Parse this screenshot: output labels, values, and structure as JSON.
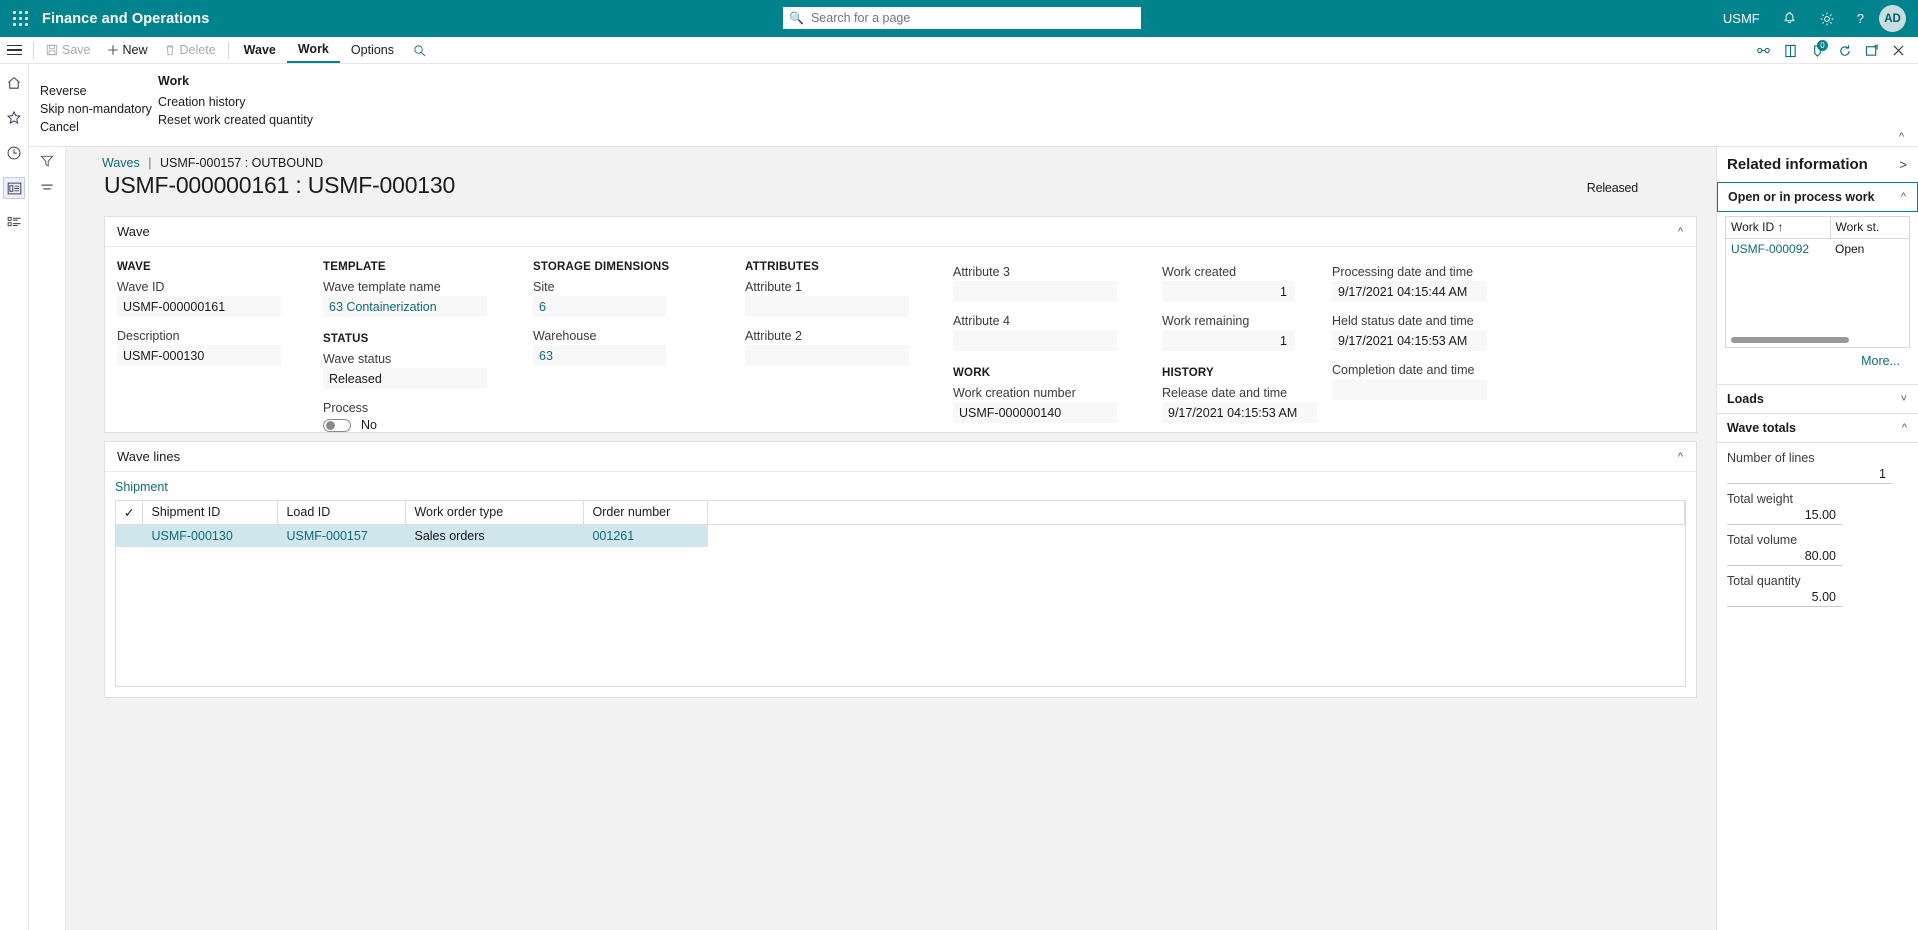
{
  "topbar": {
    "waffle_icon": "app-launcher-icon",
    "brand": "Finance and Operations",
    "search_placeholder": "Search for a page",
    "search_value": "",
    "search_icon": "search-icon",
    "company": "USMF",
    "notifications_icon": "bell-icon",
    "settings_icon": "gear-icon",
    "help_icon": "question-icon",
    "avatar_initials": "AD"
  },
  "commandbar": {
    "menu_icon": "hamburger-icon",
    "save_label": "Save",
    "save_icon": "save-icon",
    "new_label": "New",
    "new_icon": "plus-icon",
    "delete_label": "Delete",
    "delete_icon": "trash-icon",
    "tabs": [
      {
        "label": "Wave",
        "active": false,
        "bold": true
      },
      {
        "label": "Work",
        "active": true,
        "bold": true
      },
      {
        "label": "Options",
        "active": false,
        "bold": false
      }
    ],
    "find_icon": "search-icon",
    "right_icons": [
      {
        "name": "relationship-icon",
        "badge": ""
      },
      {
        "name": "attachment-icon",
        "badge": ""
      },
      {
        "name": "notes-icon",
        "badge": "0"
      },
      {
        "name": "refresh-icon",
        "badge": ""
      },
      {
        "name": "popout-icon",
        "badge": ""
      },
      {
        "name": "close-icon",
        "badge": ""
      }
    ]
  },
  "ribbon": {
    "group1": {
      "title": "",
      "items": [
        "Reverse",
        "Skip non-mandatory",
        "Cancel"
      ]
    },
    "group2": {
      "title": "Work",
      "items": [
        "Creation history",
        "Reset work created quantity"
      ]
    },
    "collapse_icon": "chevron-up-icon"
  },
  "leftrail": {
    "icons": [
      {
        "name": "home-icon",
        "selected": false
      },
      {
        "name": "favorites-star-icon",
        "selected": false
      },
      {
        "name": "recent-clock-icon",
        "selected": false
      },
      {
        "name": "workspaces-icon",
        "selected": true
      },
      {
        "name": "modules-list-icon",
        "selected": false
      }
    ]
  },
  "gutter": {
    "filter_icon": "filter-icon",
    "view-options_icon": "view-options-icon"
  },
  "breadcrumb": {
    "root": "Waves",
    "separator": "|",
    "current": "USMF-000157 : OUTBOUND"
  },
  "page": {
    "title": "USMF-000000161 : USMF-000130",
    "status": "Released"
  },
  "wave_section": {
    "header": "Wave",
    "collapse_icon": "chevron-up-icon",
    "groups": {
      "wave": {
        "header": "WAVE",
        "wave_id_label": "Wave ID",
        "wave_id_value": "USMF-000000161",
        "description_label": "Description",
        "description_value": "USMF-000130"
      },
      "template": {
        "header": "TEMPLATE",
        "template_name_label": "Wave template name",
        "template_name_value": "63 Containerization"
      },
      "status": {
        "header": "STATUS",
        "wave_status_label": "Wave status",
        "wave_status_value": "Released",
        "process_label": "Process",
        "process_toggle": "No"
      },
      "storage": {
        "header": "STORAGE DIMENSIONS",
        "site_label": "Site",
        "site_value": "6",
        "warehouse_label": "Warehouse",
        "warehouse_value": "63"
      },
      "attributes": {
        "header": "ATTRIBUTES",
        "attr1_label": "Attribute 1",
        "attr1_value": "",
        "attr2_label": "Attribute 2",
        "attr2_value": "",
        "attr3_label": "Attribute 3",
        "attr3_value": "",
        "attr4_label": "Attribute 4",
        "attr4_value": ""
      },
      "work": {
        "header": "WORK",
        "creation_number_label": "Work creation number",
        "creation_number_value": "USMF-000000140",
        "work_created_label": "Work created",
        "work_created_value": "1",
        "work_remaining_label": "Work remaining",
        "work_remaining_value": "1"
      },
      "history": {
        "header": "HISTORY",
        "release_label": "Release date and time",
        "release_value": "9/17/2021 04:15:53 AM",
        "processing_label": "Processing date and time",
        "processing_value": "9/17/2021 04:15:44 AM",
        "held_label": "Held status date and time",
        "held_value": "9/17/2021 04:15:53 AM",
        "completion_label": "Completion date and time",
        "completion_value": ""
      }
    }
  },
  "wave_lines": {
    "header": "Wave lines",
    "collapse_icon": "chevron-up-icon",
    "tab_label": "Shipment",
    "select_all_icon": "checkmark-icon",
    "columns": [
      "Shipment ID",
      "Load ID",
      "Work order type",
      "Order number"
    ],
    "rows": [
      {
        "shipment_id": "USMF-000130",
        "load_id": "USMF-000157",
        "work_order_type": "Sales orders",
        "order_number": "001261"
      }
    ]
  },
  "related_information": {
    "title": "Related information",
    "expand_icon": "chevron-right-icon",
    "sections": [
      {
        "title": "Open or in process work",
        "chevron": "chevron-up-icon",
        "active": true,
        "columns": [
          "Work ID ↑",
          "Work st."
        ],
        "rows": [
          {
            "work_id": "USMF-000092",
            "work_status": "Open"
          }
        ],
        "more_label": "More..."
      },
      {
        "title": "Loads",
        "chevron": "chevron-down-icon",
        "active": false
      },
      {
        "title": "Wave totals",
        "chevron": "chevron-up-icon",
        "active": false,
        "totals": [
          {
            "label": "Number of lines",
            "value": "1"
          },
          {
            "label": "Total weight",
            "value": "15.00"
          },
          {
            "label": "Total volume",
            "value": "80.00"
          },
          {
            "label": "Total quantity",
            "value": "5.00"
          }
        ]
      }
    ]
  },
  "colors": {
    "brand_teal": "#00838c",
    "link": "#0f6b78",
    "selected_row": "#cfe7ec",
    "page_bg": "#f2f2f2"
  }
}
